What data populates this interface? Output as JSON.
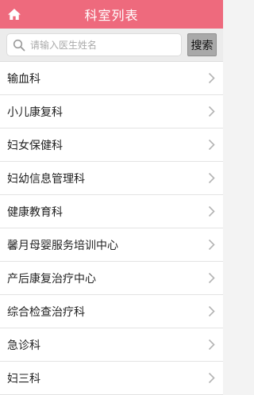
{
  "header": {
    "title": "科室列表",
    "home_icon": "home-icon",
    "background_color": "#ee6a7d"
  },
  "search": {
    "placeholder": "请输入医生姓名",
    "value": "",
    "button_label": "搜索",
    "icon": "search-icon"
  },
  "departments": [
    {
      "label": "输血科"
    },
    {
      "label": "小儿康复科"
    },
    {
      "label": "妇女保健科"
    },
    {
      "label": "妇幼信息管理科"
    },
    {
      "label": "健康教育科"
    },
    {
      "label": "馨月母婴服务培训中心"
    },
    {
      "label": "产后康复治疗中心"
    },
    {
      "label": "综合检查治疗科"
    },
    {
      "label": "急诊科"
    },
    {
      "label": "妇三科"
    }
  ],
  "list_item_icon": "chevron-right-icon"
}
